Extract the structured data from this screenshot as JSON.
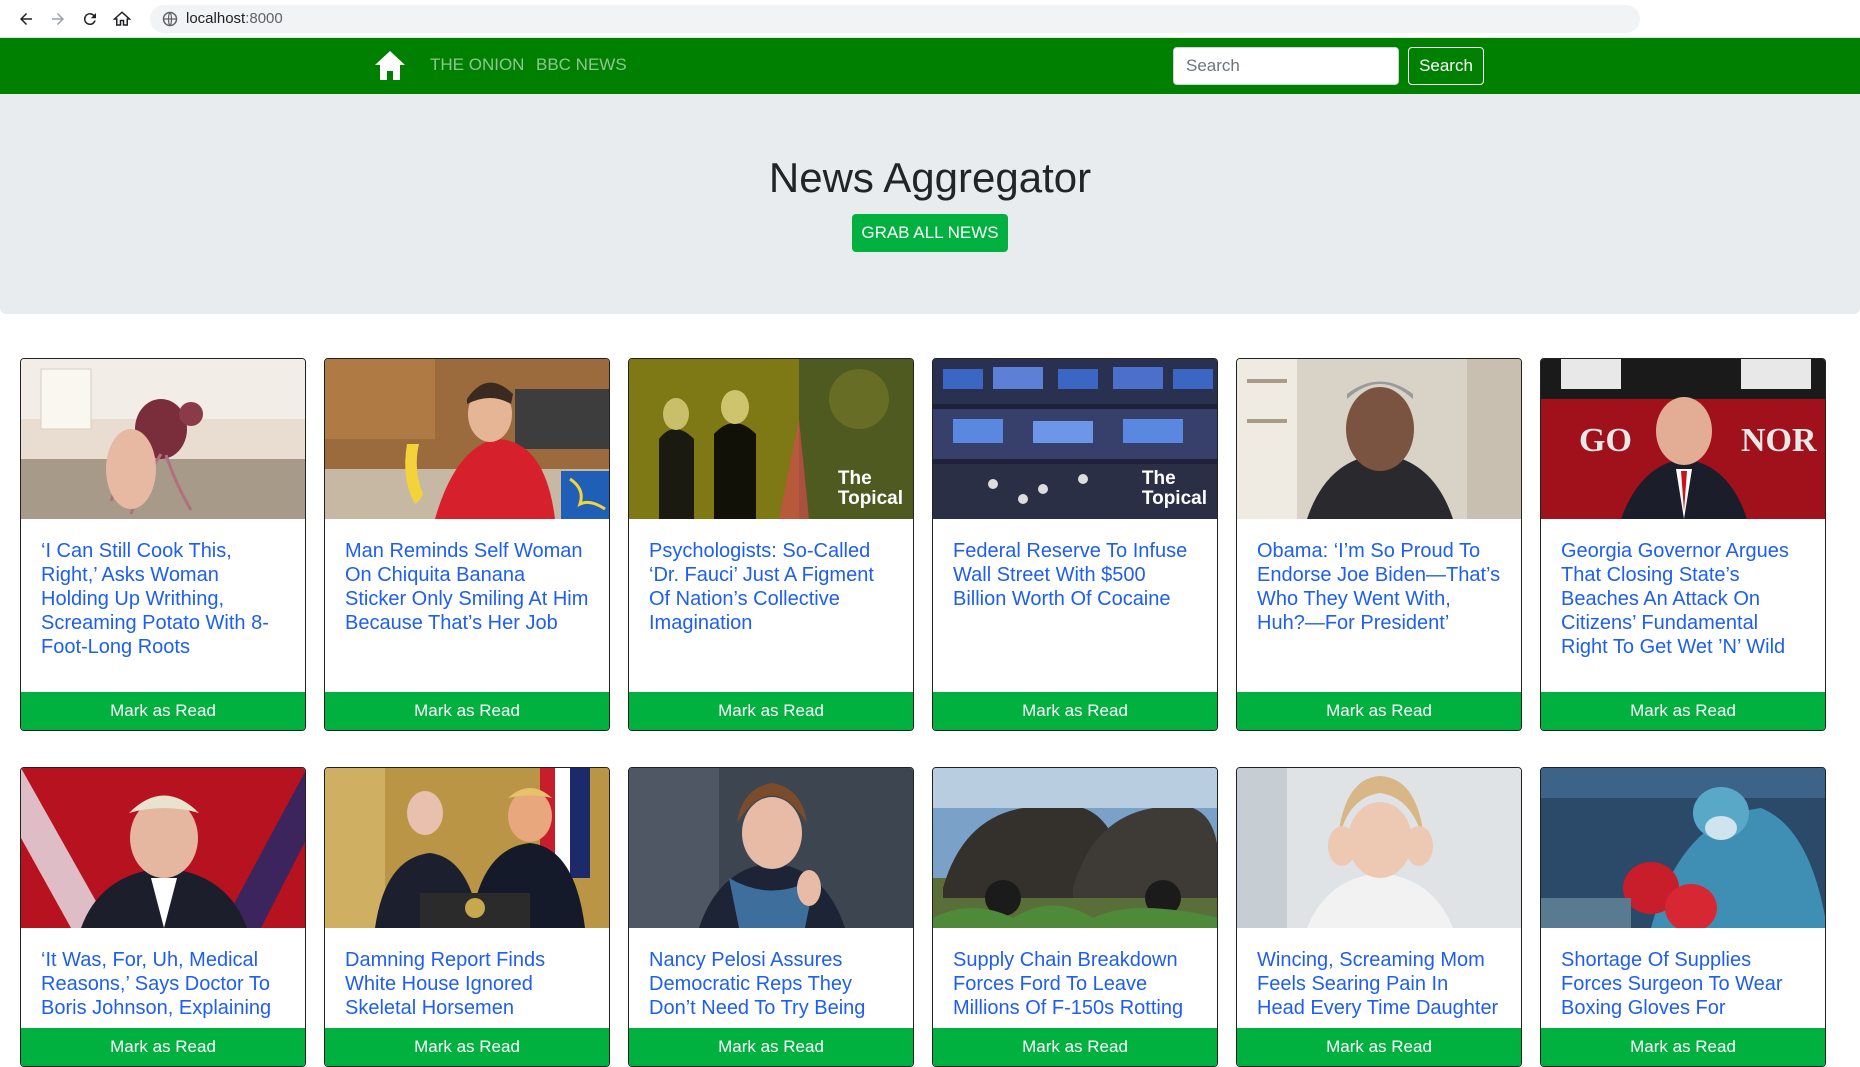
{
  "browser": {
    "host": "localhost",
    "port": ":8000"
  },
  "navbar": {
    "links": [
      "THE ONION",
      "BBC NEWS"
    ],
    "search_placeholder": "Search",
    "search_button": "Search"
  },
  "jumbotron": {
    "title": "News Aggregator",
    "grab_button": "GRAB ALL NEWS"
  },
  "cards": [
    {
      "title": "‘I Can Still Cook This, Right,’ Asks Woman Holding Up Writhing, Screaming Potato With 8-Foot-Long Roots",
      "button": "Mark as Read"
    },
    {
      "title": "Man Reminds Self Woman On Chiquita Banana Sticker Only Smiling At Him Because That’s Her Job",
      "button": "Mark as Read"
    },
    {
      "title": "Psychologists: So-Called ‘Dr. Fauci’ Just A Figment Of Nation’s Collective Imagination",
      "button": "Mark as Read",
      "overlay": "The Topical"
    },
    {
      "title": "Federal Reserve To Infuse Wall Street With $500 Billion Worth Of Cocaine",
      "button": "Mark as Read",
      "overlay": "The Topical"
    },
    {
      "title": "Obama: ‘I’m So Proud To Endorse Joe Biden—That’s Who They Went With, Huh?—For President’",
      "button": "Mark as Read"
    },
    {
      "title": "Georgia Governor Argues That Closing State’s Beaches An Attack On Citizens’ Fundamental Right To Get Wet ’N’ Wild",
      "button": "Mark as Read"
    },
    {
      "title": "‘It Was, For, Uh, Medical Reasons,’ Says Doctor To Boris Johnson, Explaining",
      "button": "Mark as Read"
    },
    {
      "title": "Damning Report Finds White House Ignored Skeletal Horsemen",
      "button": "Mark as Read"
    },
    {
      "title": "Nancy Pelosi Assures Democratic Reps They Don’t Need To Try Being",
      "button": "Mark as Read"
    },
    {
      "title": "Supply Chain Breakdown Forces Ford To Leave Millions Of F-150s Rotting",
      "button": "Mark as Read"
    },
    {
      "title": "Wincing, Screaming Mom Feels Searing Pain In Head Every Time Daughter",
      "button": "Mark as Read"
    },
    {
      "title": "Shortage Of Supplies Forces Surgeon To Wear Boxing Gloves For",
      "button": "Mark as Read"
    }
  ]
}
